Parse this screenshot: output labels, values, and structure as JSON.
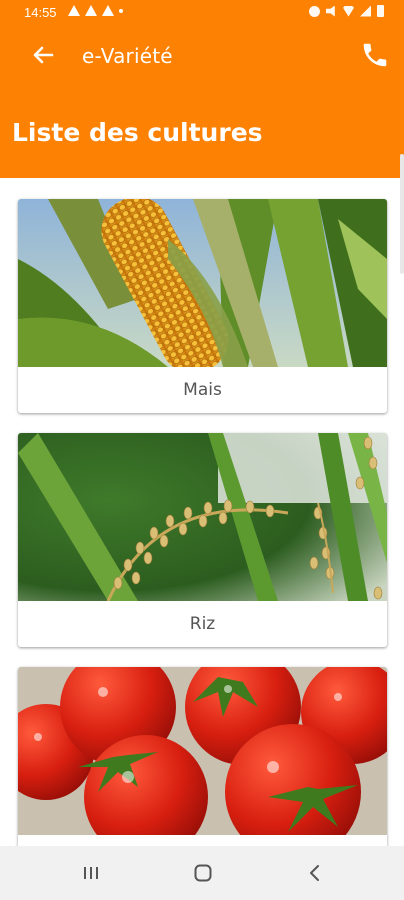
{
  "status_bar": {
    "time": "14:55"
  },
  "toolbar": {
    "title": "e-Variété",
    "back_icon": "arrow-left-icon",
    "call_icon": "phone-icon"
  },
  "page": {
    "title": "Liste des cultures"
  },
  "crops": [
    {
      "label": "Mais",
      "image": "corn-photo"
    },
    {
      "label": "Riz",
      "image": "rice-photo"
    },
    {
      "label": "",
      "image": "tomato-photo"
    }
  ],
  "nav": {
    "recent_icon": "recent-apps-icon",
    "home_icon": "home-icon",
    "back_icon": "nav-back-icon"
  },
  "colors": {
    "accent": "#fd8204",
    "label_text": "#555555",
    "nav_background": "#f1f1f1"
  }
}
